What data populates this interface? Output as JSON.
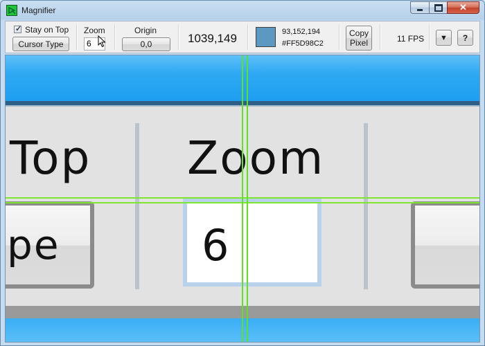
{
  "window": {
    "title": "Magnifier",
    "controls": {
      "close": "✕"
    }
  },
  "toolbar": {
    "stay_on_top": {
      "label": "Stay on Top",
      "checked": true,
      "mark": "✓"
    },
    "cursor_type_label": "Cursor Type",
    "zoom": {
      "label": "Zoom",
      "value": "6"
    },
    "origin": {
      "label": "Origin",
      "value": "0,0"
    },
    "coordinates": "1039,149",
    "color": {
      "rgb": "93,152,194",
      "hex": "#FF5D98C2",
      "swatch": "#5d98c2"
    },
    "copy_pixel_label_line1": "Copy",
    "copy_pixel_label_line2": "Pixel",
    "fps": "11 FPS",
    "dropdown_glyph": "▼",
    "help_label": "?"
  },
  "magnified": {
    "text_top": "Top",
    "text_zoom": "Zoom",
    "text_pe": "pe",
    "text_six": "6"
  },
  "colors": {
    "accent": "#2ea9f3",
    "crosshair": "#7ee62e"
  }
}
